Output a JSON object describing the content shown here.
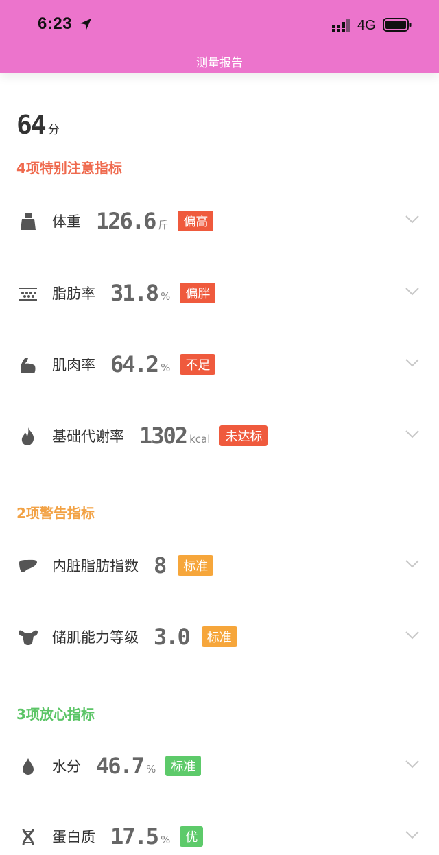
{
  "status_bar": {
    "time": "6:23",
    "network": "4G"
  },
  "header": {
    "title": "测量报告"
  },
  "score": {
    "value": "64",
    "unit": "分"
  },
  "sections": [
    {
      "title": "4项特别注意指标"
    },
    {
      "title": "2项警告指标"
    },
    {
      "title": "3项放心指标"
    }
  ],
  "metrics": [
    {
      "label": "体重",
      "value": "126.6",
      "unit": "斤",
      "badge": "偏高",
      "icon": "weight-icon"
    },
    {
      "label": "脂肪率",
      "value": "31.8",
      "unit": "%",
      "badge": "偏胖",
      "icon": "body-fat-icon"
    },
    {
      "label": "肌肉率",
      "value": "64.2",
      "unit": "%",
      "badge": "不足",
      "icon": "muscle-arm-icon"
    },
    {
      "label": "基础代谢率",
      "value": "1302",
      "unit": "kcal",
      "badge": "未达标",
      "icon": "flame-icon"
    },
    {
      "label": "内脏脂肪指数",
      "value": "8",
      "unit": "",
      "badge": "标准",
      "icon": "liver-icon"
    },
    {
      "label": "储肌能力等级",
      "value": "3.0",
      "unit": "",
      "badge": "标准",
      "icon": "muscle-torso-icon"
    },
    {
      "label": "水分",
      "value": "46.7",
      "unit": "%",
      "badge": "标准",
      "icon": "water-drop-icon"
    },
    {
      "label": "蛋白质",
      "value": "17.5",
      "unit": "%",
      "badge": "优",
      "icon": "dna-icon"
    }
  ],
  "colors": {
    "header_bg": "#ec74cc",
    "attention": "#ef6a4e",
    "warning": "#f2a245",
    "safe": "#5cc567",
    "badge_red": "#ef5a3d",
    "badge_orange": "#f6a63b",
    "badge_green": "#5dca6a"
  }
}
